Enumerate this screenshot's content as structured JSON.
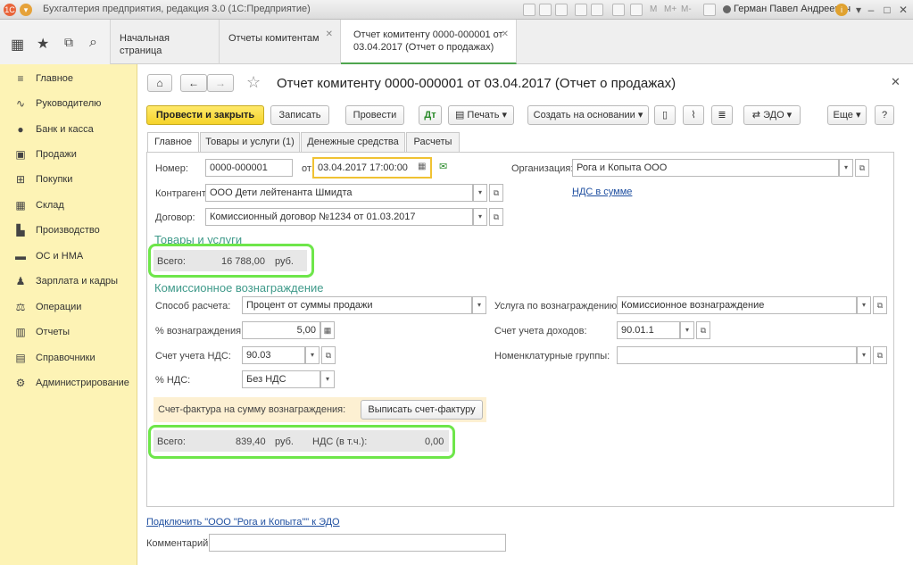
{
  "window": {
    "app_title": "Бухгалтерия предприятия, редакция 3.0  (1С:Предприятие)",
    "user": "Герман Павел Андреевич",
    "tb_m": [
      "M",
      "M+",
      "M-"
    ]
  },
  "tabs": [
    {
      "label": "Начальная страница"
    },
    {
      "label": "Отчеты комитентам"
    },
    {
      "label": "Отчет комитенту 0000-000001 от 03.04.2017 (Отчет о продажах)"
    }
  ],
  "sidebar": {
    "items": [
      {
        "label": "Главное",
        "icon": "menu-icon"
      },
      {
        "label": "Руководителю",
        "icon": "chart-line-icon"
      },
      {
        "label": "Банк и касса",
        "icon": "coin-icon"
      },
      {
        "label": "Продажи",
        "icon": "bag-icon"
      },
      {
        "label": "Покупки",
        "icon": "cart-icon"
      },
      {
        "label": "Склад",
        "icon": "grid-icon"
      },
      {
        "label": "Производство",
        "icon": "factory-icon"
      },
      {
        "label": "ОС и НМА",
        "icon": "truck-icon"
      },
      {
        "label": "Зарплата и кадры",
        "icon": "person-icon"
      },
      {
        "label": "Операции",
        "icon": "scales-icon"
      },
      {
        "label": "Отчеты",
        "icon": "bar-chart-icon"
      },
      {
        "label": "Справочники",
        "icon": "book-icon"
      },
      {
        "label": "Администрирование",
        "icon": "gear-icon"
      }
    ]
  },
  "doc": {
    "title": "Отчет комитенту 0000-000001 от 03.04.2017 (Отчет о продажах)"
  },
  "toolbar": {
    "post_close": "Провести и закрыть",
    "save": "Записать",
    "post": "Провести",
    "print": "Печать",
    "create_based": "Создать на основании",
    "edo": "ЭДО",
    "more": "Еще",
    "help": "?"
  },
  "form_tabs": [
    "Главное",
    "Товары и услуги (1)",
    "Денежные средства",
    "Расчеты"
  ],
  "form": {
    "number_label": "Номер:",
    "number": "0000-000001",
    "from_label": "от:",
    "date": "03.04.2017 17:00:00",
    "org_label": "Организация:",
    "org": "Рога и Копыта ООО",
    "nds_link": "НДС в сумме",
    "counterparty_label": "Контрагент:",
    "counterparty": "ООО Дети лейтенанта Шмидта",
    "contract_label": "Договор:",
    "contract": "Комиссионный договор №1234 от 01.03.2017",
    "goods_section": "Товары и услуги",
    "goods_total_label": "Всего:",
    "goods_total": "16 788,00",
    "currency": "руб.",
    "commission_section": "Комиссионное вознаграждение",
    "calc_method_label": "Способ расчета:",
    "calc_method": "Процент от суммы продажи",
    "service_label": "Услуга по вознаграждению:",
    "service": "Комиссионное вознаграждение",
    "percent_label": "% вознаграждения:",
    "percent": "5,00",
    "income_acc_label": "Счет учета доходов:",
    "income_acc": "90.01.1",
    "vat_acc_label": "Счет учета НДС:",
    "vat_acc": "90.03",
    "nom_groups_label": "Номенклатурные группы:",
    "nom_groups": "",
    "vat_rate_label": "% НДС:",
    "vat_rate": "Без НДС",
    "invoice_label": "Счет-фактура на сумму вознаграждения:",
    "invoice_button": "Выписать счет-фактуру",
    "comm_total_label": "Всего:",
    "comm_total": "839,40",
    "comm_vat_label": "НДС (в т.ч.):",
    "comm_vat": "0,00",
    "edo_link": "Подключить \"ООО \"Рога и Копыта\"\" к ЭДО",
    "comment_label": "Комментарий:",
    "comment": ""
  }
}
